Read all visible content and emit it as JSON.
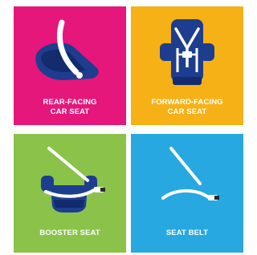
{
  "tiles": [
    {
      "line1": "REAR-FACING",
      "line2": "CAR SEAT",
      "color": "#e5177a",
      "icon": "rear-facing-car-seat-icon"
    },
    {
      "line1": "FORWARD-FACING",
      "line2": "CAR SEAT",
      "color": "#f5b116",
      "icon": "forward-facing-car-seat-icon"
    },
    {
      "line1": "BOOSTER SEAT",
      "color": "#8bc24a",
      "icon": "booster-seat-icon"
    },
    {
      "line1": "SEAT BELT",
      "color": "#28a8e0",
      "icon": "seat-belt-icon"
    }
  ],
  "colors": {
    "seat_navy": "#1d3d8f",
    "seat_navy_dark": "#132c6e",
    "belt_white": "#ffffff",
    "buckle_dark": "#2b2b2b"
  }
}
